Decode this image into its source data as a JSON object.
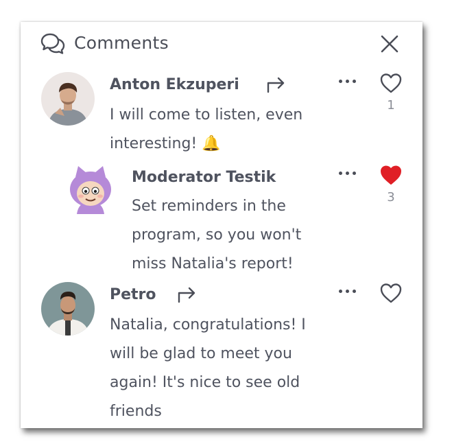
{
  "header": {
    "title": "Comments"
  },
  "comments": [
    {
      "author": "Anton Ekzuperi",
      "text": "I will come to listen, even\ninteresting! 🔔",
      "likes": "1",
      "liked": false
    },
    {
      "author": "Moderator Testik",
      "text": "Set reminders in the\nprogram, so you won't\nmiss Natalia's report!",
      "likes": "3",
      "liked": true
    },
    {
      "author": "Petro",
      "text": "Natalia, congratulations! I\nwill be glad to meet you\nagain! It's nice to see old\nfriends",
      "likes": "",
      "liked": false
    }
  ],
  "colors": {
    "text": "#4f535f",
    "heart_liked": "#e01f26",
    "heart_outline": "#4a4d57",
    "count": "#8a8d96"
  }
}
